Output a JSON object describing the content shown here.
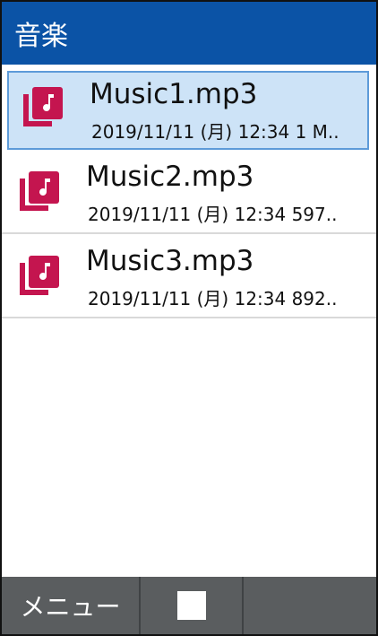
{
  "header": {
    "title": "音楽"
  },
  "files": [
    {
      "name": "Music1.mp3",
      "meta": "2019/11/11 (月) 12:34  1 M..",
      "selected": true
    },
    {
      "name": "Music2.mp3",
      "meta": "2019/11/11 (月) 12:34  597..",
      "selected": false
    },
    {
      "name": "Music3.mp3",
      "meta": "2019/11/11 (月) 12:34  892..",
      "selected": false
    }
  ],
  "softkeys": {
    "left_label": "メニュー",
    "center_icon": "stop-icon",
    "right_label": ""
  },
  "colors": {
    "header": "#0b53a6",
    "accent_icon": "#c4154f",
    "selection": "#cde3f7",
    "softkey_bar": "#5a5d5f"
  }
}
